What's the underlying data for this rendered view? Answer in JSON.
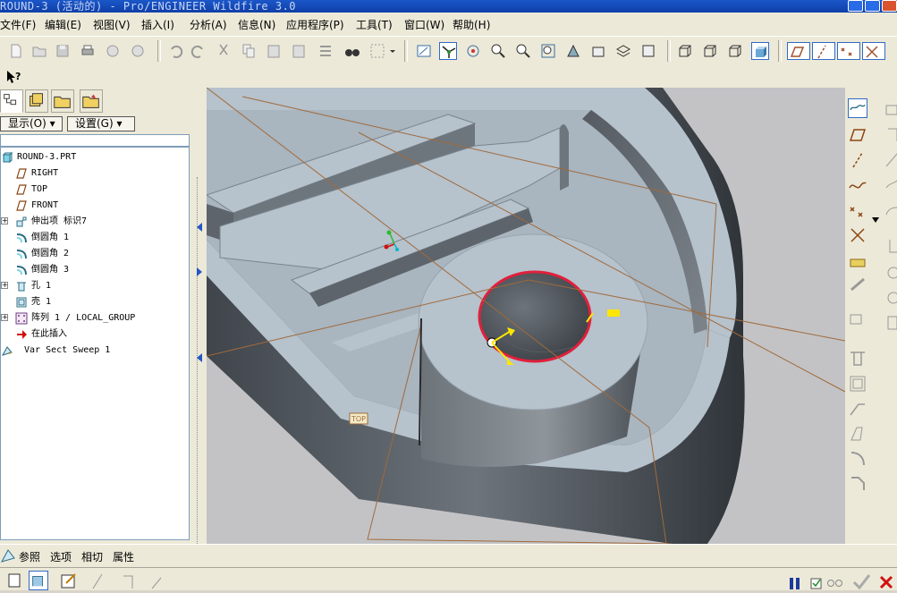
{
  "window": {
    "title": "ROUND-3 (活动的) - Pro/ENGINEER Wildfire 3.0"
  },
  "menu": [
    {
      "label": "文件(F)"
    },
    {
      "label": "编辑(E)"
    },
    {
      "label": "视图(V)"
    },
    {
      "label": "插入(I)"
    },
    {
      "label": "分析(A)"
    },
    {
      "label": "信息(N)"
    },
    {
      "label": "应用程序(P)"
    },
    {
      "label": "工具(T)"
    },
    {
      "label": "窗口(W)"
    },
    {
      "label": "帮助(H)"
    }
  ],
  "help_icon": "whats-this-help-icon",
  "left_panel": {
    "show_button": "显示(O) ▾",
    "settings_button": "设置(G) ▾",
    "tree": [
      {
        "label": "ROUND-3.PRT",
        "icon": "part-icon",
        "expander": ""
      },
      {
        "label": "RIGHT",
        "icon": "datum-plane-icon",
        "expander": ""
      },
      {
        "label": "TOP",
        "icon": "datum-plane-icon",
        "expander": ""
      },
      {
        "label": "FRONT",
        "icon": "datum-plane-icon",
        "expander": ""
      },
      {
        "label": "伸出项 标识7",
        "icon": "extrude-icon",
        "expander": "+"
      },
      {
        "label": "倒圆角 1",
        "icon": "round-icon",
        "expander": ""
      },
      {
        "label": "倒圆角 2",
        "icon": "round-icon",
        "expander": ""
      },
      {
        "label": "倒圆角 3",
        "icon": "round-icon",
        "expander": ""
      },
      {
        "label": "孔 1",
        "icon": "hole-icon",
        "expander": "+"
      },
      {
        "label": "壳 1",
        "icon": "shell-icon",
        "expander": ""
      },
      {
        "label": "阵列 1 / LOCAL_GROUP",
        "icon": "pattern-icon",
        "expander": "+"
      },
      {
        "label": "在此插入",
        "icon": "insert-here-arrow-icon",
        "expander": ""
      },
      {
        "label": "Var Sect Sweep 1",
        "icon": "var-sect-sweep-icon",
        "expander": ""
      }
    ]
  },
  "viewport": {
    "datum_tag": "TOP"
  },
  "dashboard": {
    "tabs": [
      {
        "label": "参照"
      },
      {
        "label": "选项"
      },
      {
        "label": "相切"
      },
      {
        "label": "属性"
      }
    ]
  },
  "colors": {
    "model_face": "#b6c2cc",
    "model_side": "#5d646b",
    "selection_edge": "#e0203c",
    "datum_plane": "#a06a3c",
    "background": "#c3c3c5"
  }
}
